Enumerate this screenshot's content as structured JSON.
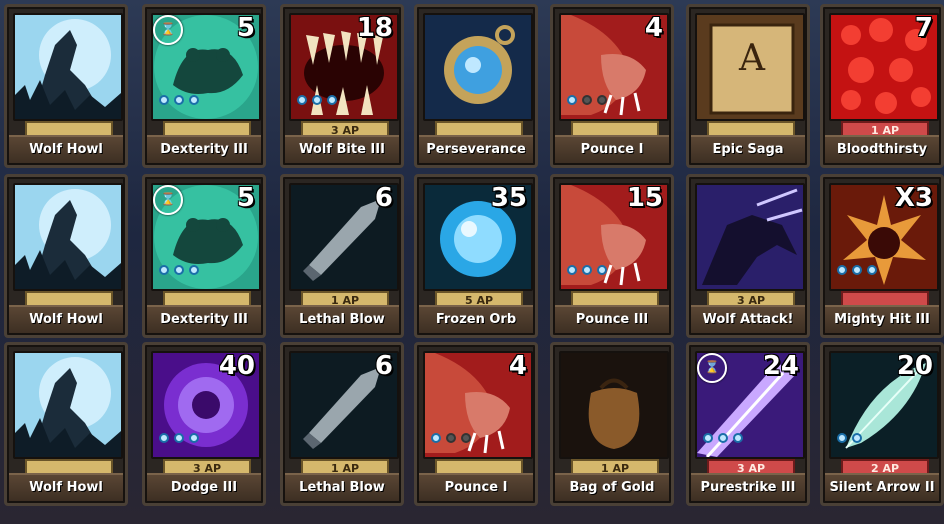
{
  "cards": [
    {
      "name": "Wolf Howl",
      "cost": "",
      "ap": "",
      "timer": false,
      "pips": [],
      "art": "wolf-howl",
      "ap_style": "gold"
    },
    {
      "name": "Dexterity III",
      "cost": "5",
      "ap": "",
      "timer": true,
      "pips": [
        1,
        1,
        1
      ],
      "art": "frog",
      "ap_style": "gold"
    },
    {
      "name": "Wolf Bite III",
      "cost": "18",
      "ap": "3 AP",
      "timer": false,
      "pips": [
        1,
        1,
        1
      ],
      "art": "bite",
      "ap_style": "gold"
    },
    {
      "name": "Perseverance",
      "cost": "",
      "ap": "",
      "timer": false,
      "pips": [],
      "art": "amulet",
      "ap_style": "gold"
    },
    {
      "name": "Pounce I",
      "cost": "4",
      "ap": "",
      "timer": false,
      "pips": [
        1,
        0,
        0
      ],
      "art": "claw",
      "ap_style": "gold"
    },
    {
      "name": "Epic Saga",
      "cost": "",
      "ap": "",
      "timer": false,
      "pips": [],
      "art": "book",
      "ap_style": "gold"
    },
    {
      "name": "Bloodthirsty",
      "cost": "7",
      "ap": "1 AP",
      "timer": false,
      "pips": [],
      "art": "blood",
      "ap_style": "red"
    },
    {
      "name": "Wolf Howl",
      "cost": "",
      "ap": "",
      "timer": false,
      "pips": [],
      "art": "wolf-howl",
      "ap_style": "gold"
    },
    {
      "name": "Dexterity III",
      "cost": "5",
      "ap": "",
      "timer": true,
      "pips": [
        1,
        1,
        1
      ],
      "art": "frog",
      "ap_style": "gold"
    },
    {
      "name": "Lethal Blow",
      "cost": "6",
      "ap": "1 AP",
      "timer": false,
      "pips": [],
      "art": "blade",
      "ap_style": "gold"
    },
    {
      "name": "Frozen Orb",
      "cost": "35",
      "ap": "5 AP",
      "timer": false,
      "pips": [],
      "art": "orb",
      "ap_style": "gold"
    },
    {
      "name": "Pounce III",
      "cost": "15",
      "ap": "",
      "timer": false,
      "pips": [
        1,
        1,
        1
      ],
      "art": "claw",
      "ap_style": "gold"
    },
    {
      "name": "Wolf Attack!",
      "cost": "",
      "ap": "3 AP",
      "timer": false,
      "pips": [],
      "art": "wolf-attack",
      "ap_style": "gold"
    },
    {
      "name": "Mighty Hit III",
      "cost": "X3",
      "ap": "",
      "timer": false,
      "pips": [
        1,
        1,
        1
      ],
      "art": "mighty",
      "ap_style": "red"
    },
    {
      "name": "Wolf Howl",
      "cost": "",
      "ap": "",
      "timer": false,
      "pips": [],
      "art": "wolf-howl",
      "ap_style": "gold"
    },
    {
      "name": "Dodge III",
      "cost": "40",
      "ap": "3 AP",
      "timer": false,
      "pips": [
        1,
        1,
        1
      ],
      "art": "vortex",
      "ap_style": "gold"
    },
    {
      "name": "Lethal Blow",
      "cost": "6",
      "ap": "1 AP",
      "timer": false,
      "pips": [],
      "art": "blade",
      "ap_style": "gold"
    },
    {
      "name": "Pounce I",
      "cost": "4",
      "ap": "",
      "timer": false,
      "pips": [
        1,
        0,
        0
      ],
      "art": "claw",
      "ap_style": "gold"
    },
    {
      "name": "Bag of Gold",
      "cost": "",
      "ap": "1 AP",
      "timer": false,
      "pips": [],
      "art": "bag",
      "ap_style": "gold"
    },
    {
      "name": "Purestrike III",
      "cost": "24",
      "ap": "3 AP",
      "timer": true,
      "pips": [
        1,
        1,
        1
      ],
      "art": "purestrike",
      "ap_style": "red"
    },
    {
      "name": "Silent Arrow II",
      "cost": "20",
      "ap": "2 AP",
      "timer": false,
      "pips": [
        1,
        1
      ],
      "art": "feather",
      "ap_style": "red"
    }
  ]
}
